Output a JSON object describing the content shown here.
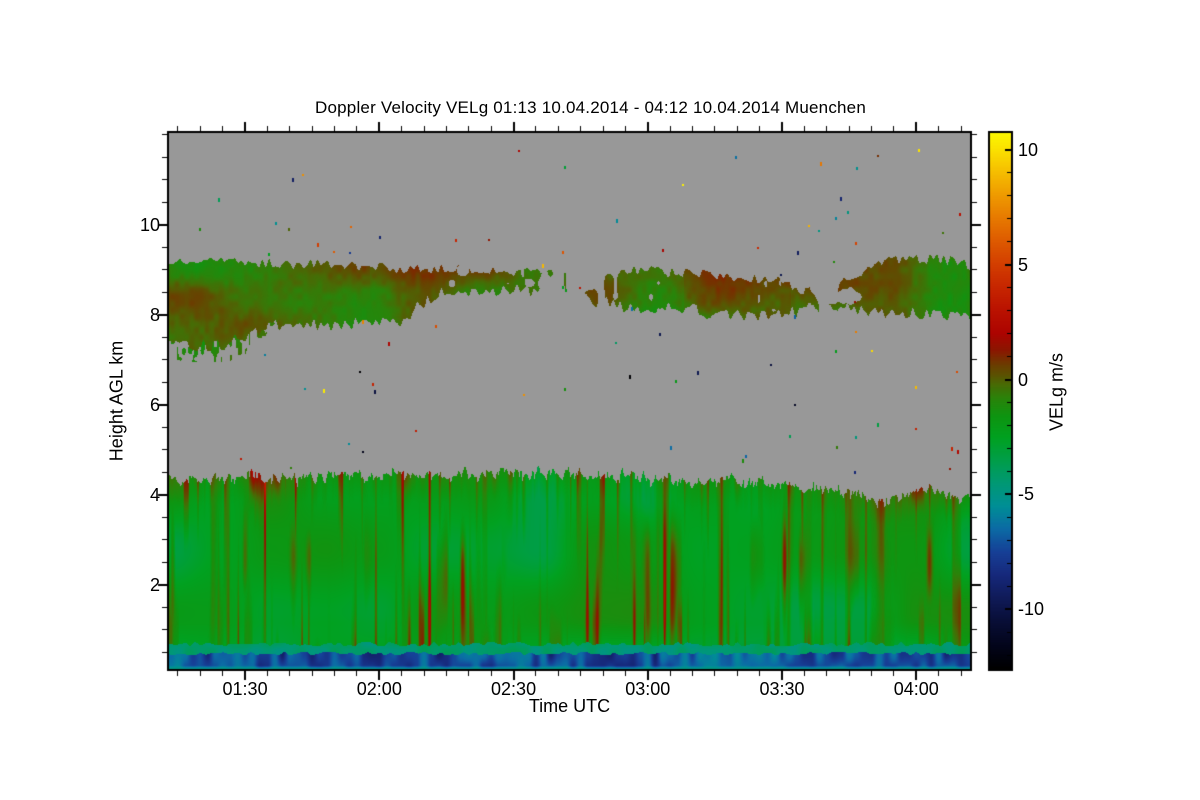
{
  "chart_data": {
    "type": "heatmap",
    "title": "Doppler Velocity VELg   01:13 10.04.2014 - 04:12 10.04.2014 Muenchen",
    "instrument_product": "Doppler Velocity VELg",
    "time_start": "01:13 10.04.2014",
    "time_end": "04:12 10.04.2014",
    "station": "Muenchen",
    "xlabel": "Time UTC",
    "ylabel": "Height AGL km",
    "colorbar_label": "VELg m/s",
    "no_data_color": "#989898",
    "x_axis": {
      "units": "UTC minutes after 00:00",
      "start_min": 73,
      "end_min": 252,
      "major_ticks": [
        {
          "min": 90,
          "label": "01:30"
        },
        {
          "min": 120,
          "label": "02:00"
        },
        {
          "min": 150,
          "label": "02:30"
        },
        {
          "min": 180,
          "label": "03:00"
        },
        {
          "min": 210,
          "label": "03:30"
        },
        {
          "min": 240,
          "label": "04:00"
        }
      ],
      "minor_step_min": 5
    },
    "y_axis": {
      "units": "km AGL",
      "min": 0.13,
      "max": 12.04,
      "major_ticks": [
        2,
        4,
        6,
        8,
        10
      ],
      "minor_step": 0.5
    },
    "colorbar": {
      "units": "m/s",
      "vmin": -12.6,
      "vmax": 10.74,
      "major_ticks": [
        10,
        5,
        0,
        -5,
        -10
      ],
      "minor_step": 1,
      "colormap_stops": [
        [
          10.74,
          "#fcf800"
        ],
        [
          10,
          "#fbe100"
        ],
        [
          9,
          "#f6bd00"
        ],
        [
          8,
          "#ef9a00"
        ],
        [
          7,
          "#e77900"
        ],
        [
          6,
          "#de5a00"
        ],
        [
          5,
          "#d33e00"
        ],
        [
          4,
          "#c72600"
        ],
        [
          3,
          "#ba1200"
        ],
        [
          2,
          "#ad0400"
        ],
        [
          1.3,
          "#8d1600"
        ],
        [
          0.7,
          "#6e3a00"
        ],
        [
          0.2,
          "#5c5202"
        ],
        [
          -0.2,
          "#496a05"
        ],
        [
          -0.8,
          "#2b830a"
        ],
        [
          -1.6,
          "#0e9511"
        ],
        [
          -2.5,
          "#01a120"
        ],
        [
          -3.5,
          "#009e49"
        ],
        [
          -4.5,
          "#009974"
        ],
        [
          -5.5,
          "#008f96"
        ],
        [
          -6.5,
          "#0c6ba5"
        ],
        [
          -7.5,
          "#164097"
        ],
        [
          -8.5,
          "#16297c"
        ],
        [
          -9.5,
          "#101b59"
        ],
        [
          -10.5,
          "#090f38"
        ],
        [
          -11.6,
          "#03051b"
        ],
        [
          -12.6,
          "#000000"
        ]
      ]
    },
    "layers": {
      "cloud_band": {
        "description": "mid-level cloud layer 7.3-9.25 km, VELg near 0 m/s (olive/green, brownish patches)",
        "v_mean": -0.6,
        "v_spread": 1.1,
        "v_brown_bias_max": 1.3,
        "nodes_t_bottom_top_density": [
          [
            73,
            7.35,
            9.15,
            1
          ],
          [
            85,
            7.3,
            9.18,
            1
          ],
          [
            95,
            7.75,
            9.15,
            1
          ],
          [
            115,
            7.8,
            9.1,
            1
          ],
          [
            125,
            7.85,
            9.05,
            0.95
          ],
          [
            128,
            8.15,
            9.0,
            0.9
          ],
          [
            135,
            8.55,
            9.05,
            0.85
          ],
          [
            150,
            8.55,
            8.95,
            0.8
          ],
          [
            158,
            8.5,
            8.9,
            0.55
          ],
          [
            163,
            8.45,
            8.85,
            0.15
          ],
          [
            168,
            8.3,
            8.9,
            0.5
          ],
          [
            175,
            8.2,
            9.0,
            0.9
          ],
          [
            190,
            8.1,
            8.9,
            0.95
          ],
          [
            196,
            8.0,
            8.9,
            1
          ],
          [
            210,
            8.0,
            8.75,
            0.9
          ],
          [
            216,
            8.1,
            8.5,
            0.6
          ],
          [
            222,
            8.2,
            8.6,
            0.25
          ],
          [
            228,
            8.05,
            9.0,
            0.85
          ],
          [
            235,
            8.0,
            9.2,
            1
          ],
          [
            245,
            8.05,
            9.25,
            1
          ],
          [
            252,
            7.9,
            9.1,
            0.95
          ]
        ],
        "left_wisp_until_min": 98,
        "left_wisp_floor_km": 6.95
      },
      "boundary_layer": {
        "description": "aerosol boundary layer from surface to ~4.3 km, mostly -3..0 m/s green with red updraft streaks to ~+4 m/s",
        "v_mean": -2.35,
        "v_spread": 1.2,
        "updraft_streak_vmax": 4.5,
        "top_nodes_t_h": [
          [
            73,
            4.3
          ],
          [
            90,
            4.4
          ],
          [
            105,
            4.35
          ],
          [
            120,
            4.45
          ],
          [
            135,
            4.4
          ],
          [
            150,
            4.5
          ],
          [
            160,
            4.45
          ],
          [
            175,
            4.4
          ],
          [
            190,
            4.3
          ],
          [
            205,
            4.28
          ],
          [
            215,
            4.15
          ],
          [
            228,
            4.0
          ],
          [
            233,
            3.85
          ],
          [
            238,
            4.1
          ],
          [
            242,
            4.2
          ],
          [
            247,
            3.95
          ],
          [
            252,
            3.92
          ]
        ],
        "edge_jitter_km": 0.3
      },
      "transition_band": {
        "description": "near-surface teal band",
        "h_range_km": [
          0.47,
          0.68
        ],
        "v_mean": -4.35
      },
      "surface_strip": {
        "description": "lowest gates, strong negative velocities (teal to navy/black patches)",
        "h_range_km": [
          0.13,
          0.47
        ],
        "v_range": [
          -9.4,
          -4.9
        ],
        "darkness_nodes_t_frac": [
          [
            73,
            0.45
          ],
          [
            81,
            0.9
          ],
          [
            100,
            1
          ],
          [
            150,
            1
          ],
          [
            183,
            0.95
          ],
          [
            193,
            0.5
          ],
          [
            205,
            0.5
          ],
          [
            213,
            0.8
          ],
          [
            230,
            0.9
          ],
          [
            252,
            0.95
          ]
        ]
      },
      "speckles": {
        "description": "isolated noise pixels scattered in the no-data (gray) region",
        "count": 85,
        "seed": 7,
        "v_random_range": [
          -12.5,
          10.7
        ]
      }
    }
  }
}
